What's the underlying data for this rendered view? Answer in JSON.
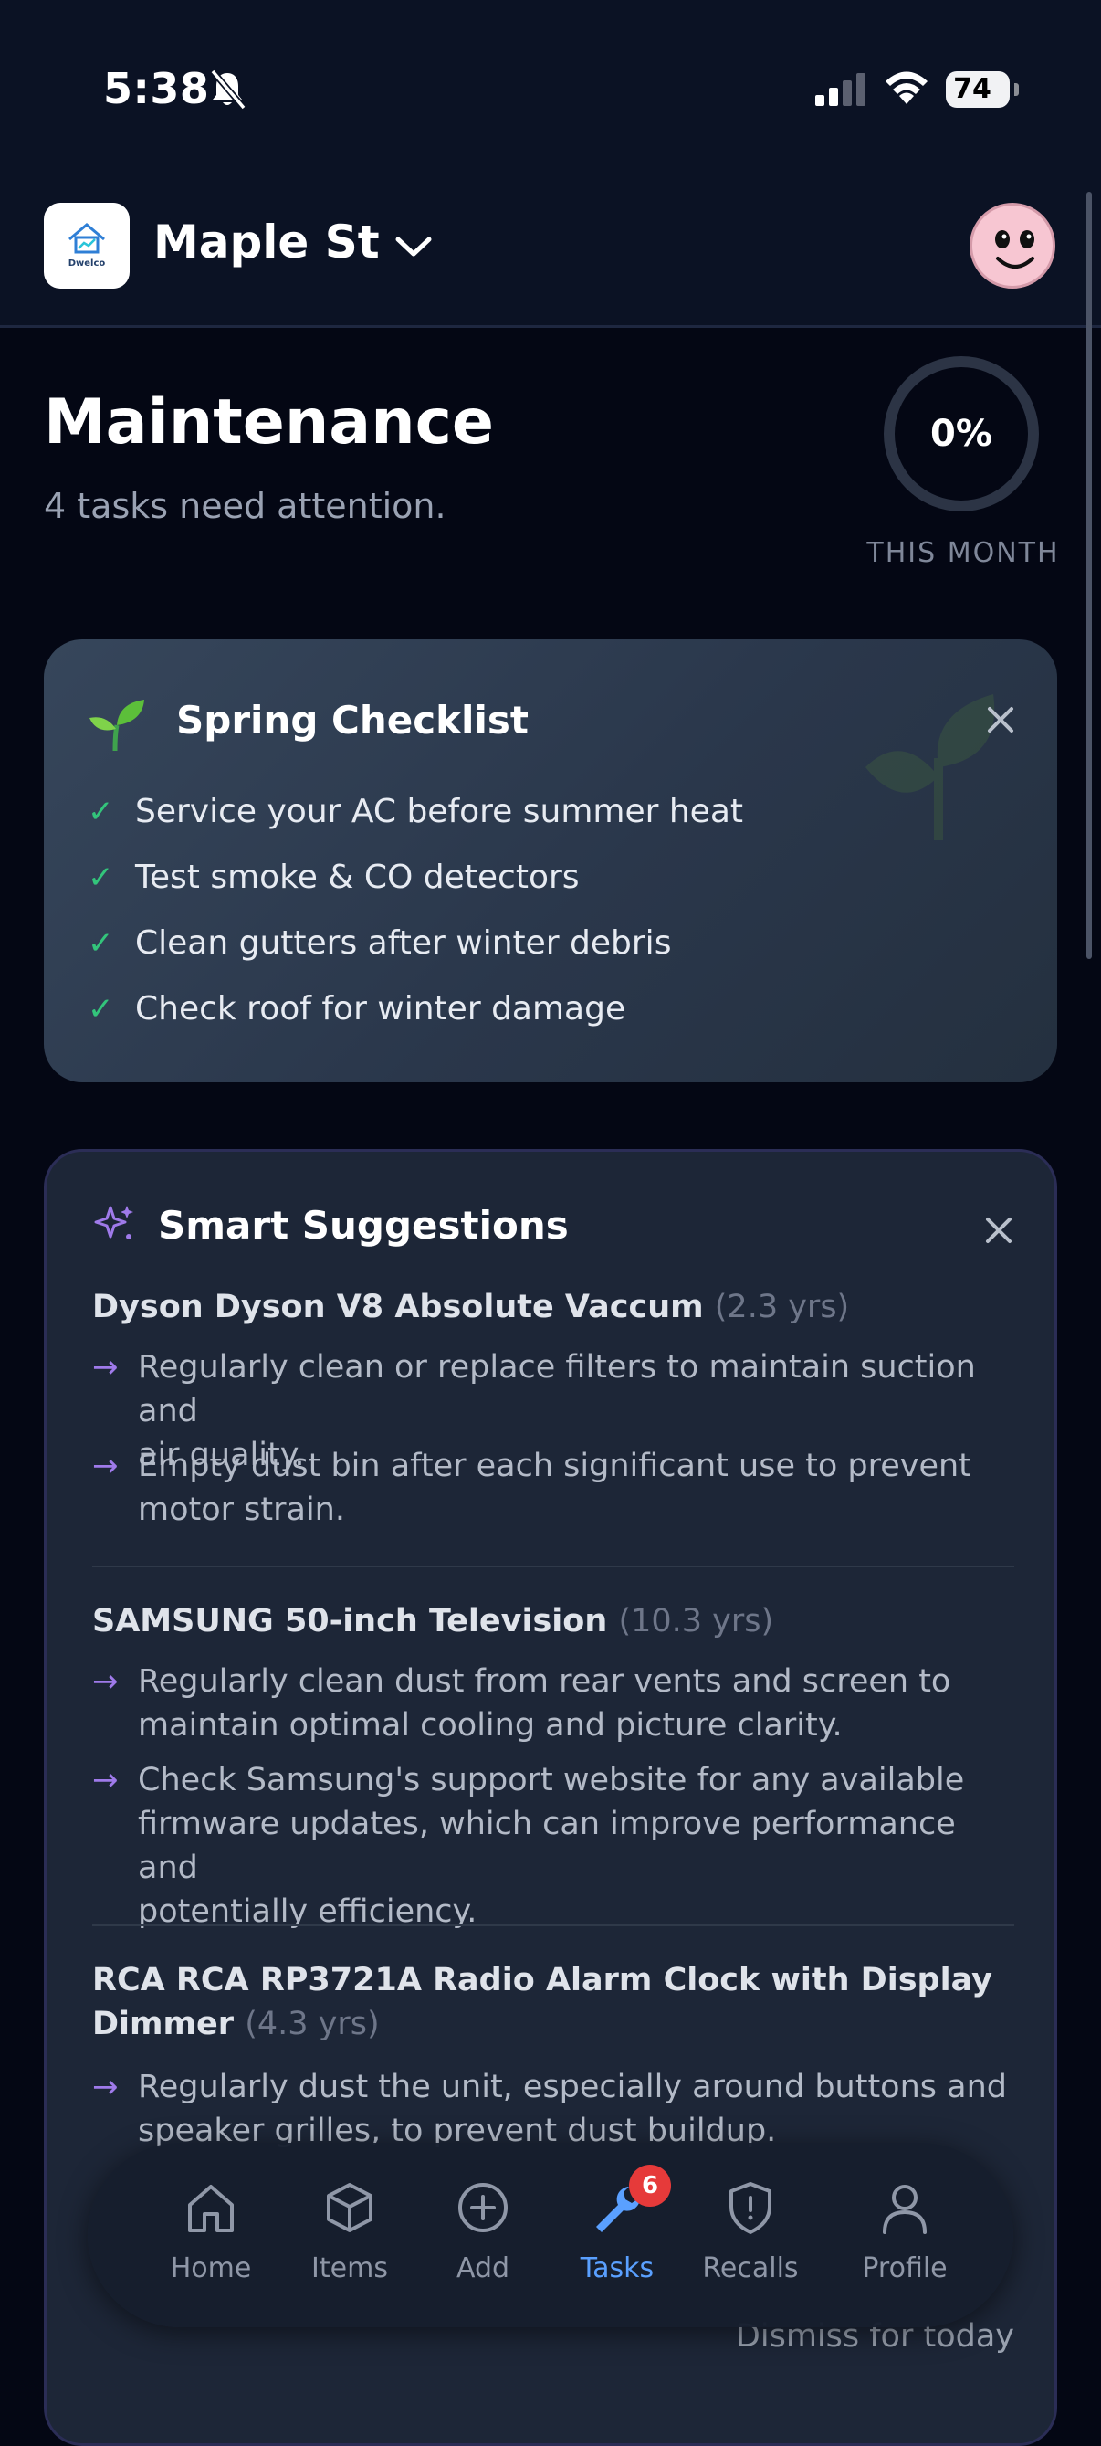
{
  "status_bar": {
    "time": "5:38",
    "battery": "74"
  },
  "header": {
    "address": "Maple St",
    "logo_text": "Dwelco"
  },
  "page": {
    "title": "Maintenance",
    "subtitle": "4 tasks need attention."
  },
  "progress": {
    "label": "0%",
    "value": 0,
    "caption": "THIS MONTH"
  },
  "spring_checklist": {
    "title": "Spring Checklist",
    "items": [
      "Service your AC before summer heat",
      "Test smoke & CO detectors",
      "Clean gutters after winter debris",
      "Check roof for winter damage"
    ]
  },
  "smart_suggestions": {
    "title": "Smart Suggestions",
    "items": [
      {
        "name": "Dyson Dyson V8 Absolute Vaccum",
        "age": "(2.3 yrs)",
        "tips": [
          [
            "Regularly clean or replace filters to maintain suction and",
            "air quality."
          ],
          [
            "Empty dust bin after each significant use to prevent",
            "motor strain."
          ]
        ]
      },
      {
        "name": "SAMSUNG 50-inch Television",
        "age": "(10.3 yrs)",
        "tips": [
          [
            "Regularly clean dust from rear vents and screen to",
            "maintain optimal cooling and picture clarity."
          ],
          [
            "Check Samsung's support website for any available",
            "firmware updates, which can improve performance and",
            "potentially efficiency."
          ]
        ]
      },
      {
        "name": "RCA RCA RP3721A Radio Alarm Clock with Display",
        "name_line2": "Dimmer",
        "age": "(4.3 yrs)",
        "tips": [
          [
            "Regularly dust the unit, especially around buttons and",
            "speaker grilles, to prevent dust buildup."
          ]
        ]
      }
    ],
    "dismiss": "Dismiss for today"
  },
  "nav": {
    "items": [
      {
        "label": "Home",
        "icon": "home-icon"
      },
      {
        "label": "Items",
        "icon": "box-icon"
      },
      {
        "label": "Add",
        "icon": "plus-circle-icon"
      },
      {
        "label": "Tasks",
        "icon": "wrench-icon",
        "badge": "6",
        "active": true
      },
      {
        "label": "Recalls",
        "icon": "shield-alert-icon"
      },
      {
        "label": "Profile",
        "icon": "user-icon"
      }
    ]
  },
  "colors": {
    "accent": "#5aa0ff",
    "check": "#33c57b",
    "arrow": "#9f7aea",
    "badge": "#e63a3a"
  }
}
